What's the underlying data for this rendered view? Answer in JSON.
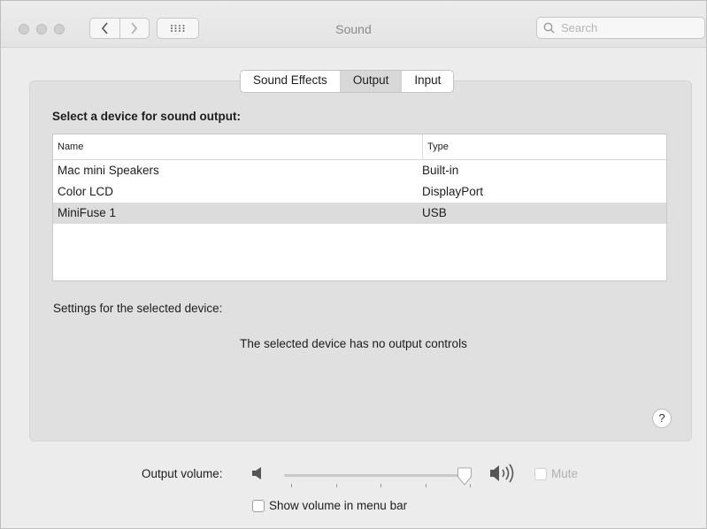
{
  "window": {
    "title": "Sound"
  },
  "toolbar": {
    "search": {
      "placeholder": "Search"
    },
    "icons": [
      "back-chevron-icon",
      "forward-chevron-icon",
      "grid-icon",
      "magnifier-icon"
    ]
  },
  "tabs": [
    {
      "label": "Sound Effects",
      "selected": false
    },
    {
      "label": "Output",
      "selected": true
    },
    {
      "label": "Input",
      "selected": false
    }
  ],
  "output": {
    "heading": "Select a device for sound output:",
    "columns": {
      "name": "Name",
      "type": "Type"
    },
    "devices": [
      {
        "name": "Mac mini Speakers",
        "type": "Built-in",
        "selected": false
      },
      {
        "name": "Color LCD",
        "type": "DisplayPort",
        "selected": false
      },
      {
        "name": "MiniFuse 1",
        "type": "USB",
        "selected": true
      }
    ],
    "settings_label": "Settings for the selected device:",
    "no_controls_message": "The selected device has no output controls",
    "help_label": "?"
  },
  "volume": {
    "label": "Output volume:",
    "level": 0.96,
    "mute_label": "Mute",
    "mute_checked": false,
    "show_in_menu_bar_label": "Show volume in menu bar",
    "show_in_menu_bar_checked": false
  },
  "colors": {
    "selected_row": "#dcdcdc",
    "window_bg": "#ececec"
  }
}
